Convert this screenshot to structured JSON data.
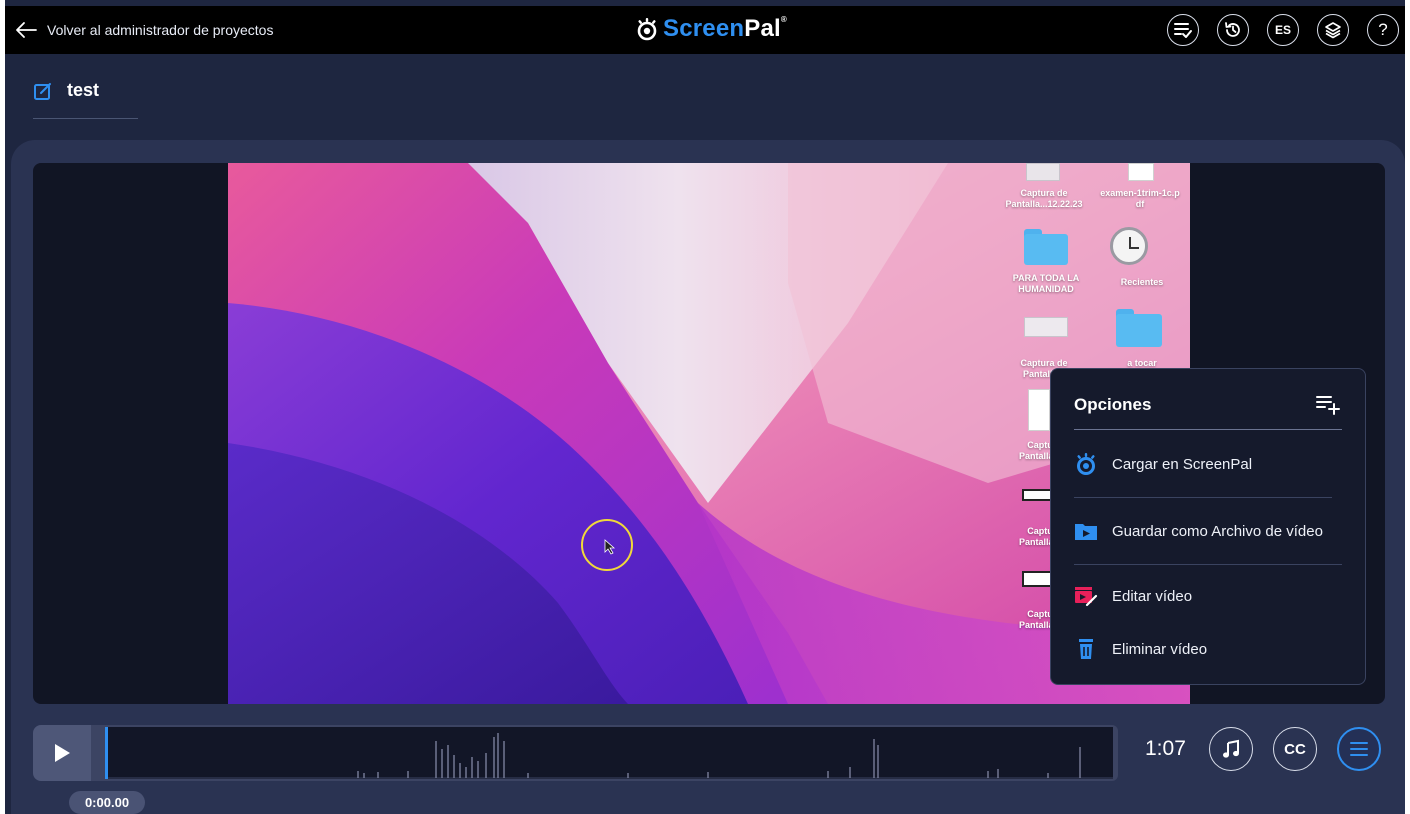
{
  "topbar": {
    "back_label": "Volver al administrador de proyectos",
    "logo_screen": "Screen",
    "logo_pal": "Pal",
    "logo_reg": "®",
    "lang_label": "ES",
    "help_label": "?"
  },
  "project": {
    "title": "test"
  },
  "desktop": {
    "icons": [
      {
        "label_1": "Captura de",
        "label_2": "Pantalla...12.22.23"
      },
      {
        "label_1": "examen-1trim-1c.p",
        "label_2": "df"
      },
      {
        "label_1": "PARA TODA LA",
        "label_2": "HUMANIDAD"
      },
      {
        "label_1": "Recientes",
        "label_2": ""
      },
      {
        "label_1": "Captura de",
        "label_2": "Pantalla..."
      },
      {
        "label_1": "a tocar",
        "label_2": ""
      },
      {
        "label_1": "Captu",
        "label_2": "Pantalla..."
      },
      {
        "label_1": "Captu",
        "label_2": "Pantalla..."
      },
      {
        "label_1": "Captu",
        "label_2": "Pantalla..."
      }
    ]
  },
  "options_menu": {
    "title": "Opciones",
    "items": [
      {
        "label": "Cargar en ScreenPal",
        "icon": "screenpal-logo-icon"
      },
      {
        "label": "Guardar como Archivo de vídeo",
        "icon": "folder-video-icon"
      },
      {
        "label": "Editar vídeo",
        "icon": "edit-video-icon"
      },
      {
        "label": "Eliminar vídeo",
        "icon": "trash-icon"
      }
    ]
  },
  "player": {
    "duration": "1:07",
    "timecode": "0:00.00",
    "cc_label": "CC"
  },
  "colors": {
    "accent": "#2f8ff0",
    "app_bg": "#1e2640",
    "panel_bg": "#2a3352",
    "topbar_bg": "#000000",
    "edit_icon_color": "#e8205a"
  }
}
